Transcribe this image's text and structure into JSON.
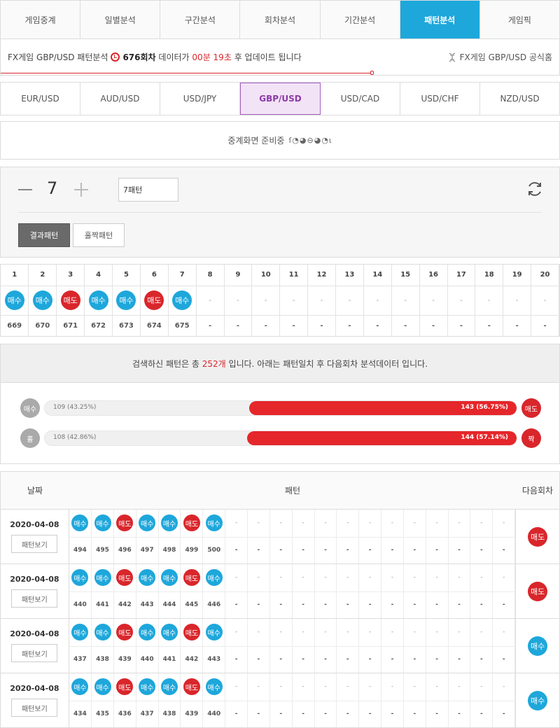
{
  "nav": {
    "tabs": [
      "게임중계",
      "일별분석",
      "구간분석",
      "회차분석",
      "기간분석",
      "패턴분석",
      "게임픽"
    ],
    "active_index": 5
  },
  "info": {
    "prefix": "FX게임 GBP/USD 패턴분석",
    "round": "676회차",
    "middle": "데이터가",
    "countdown": "00분 19초",
    "suffix": "후 업데이트 됩니다",
    "official_link": "FX게임 GBP/USD 공식홈"
  },
  "pairs": {
    "items": [
      "EUR/USD",
      "AUD/USD",
      "USD/JPY",
      "GBP/USD",
      "USD/CAD",
      "USD/CHF",
      "NZD/USD"
    ],
    "active_index": 3
  },
  "notice": {
    "text": "중계화면 준비중",
    "loader": "ſ◔◕⊖◕◔ɩ"
  },
  "control": {
    "stepper_value": "7",
    "pattern_select": "7패턴",
    "result_pattern_label": "결과패턴",
    "oddeven_pattern_label": "홀짝패턴"
  },
  "grid": {
    "columns": [
      "1",
      "2",
      "3",
      "4",
      "5",
      "6",
      "7",
      "8",
      "9",
      "10",
      "11",
      "12",
      "13",
      "14",
      "15",
      "16",
      "17",
      "18",
      "19",
      "20"
    ],
    "results": [
      "매수",
      "매수",
      "매도",
      "매수",
      "매수",
      "매도",
      "매수",
      "-",
      "-",
      "-",
      "-",
      "-",
      "-",
      "-",
      "-",
      "-",
      "-",
      "-",
      "-",
      "-"
    ],
    "rounds": [
      "669",
      "670",
      "671",
      "672",
      "673",
      "674",
      "675",
      "-",
      "-",
      "-",
      "-",
      "-",
      "-",
      "-",
      "-",
      "-",
      "-",
      "-",
      "-",
      "-"
    ]
  },
  "summary": {
    "prefix": "검색하신 패턴은 총",
    "count": "252개",
    "suffix": "입니다. 아래는 패턴일치 후 다음회차 분석데이터 입니다."
  },
  "stats": {
    "buy_sell": {
      "left_label": "매수",
      "left_text": "109 (43.25%)",
      "right_text": "143 (56.75%)",
      "right_label": "매도",
      "right_pct": 56.75
    },
    "odd_even": {
      "left_label": "홀",
      "left_text": "108 (42.86%)",
      "right_text": "144 (57.14%)",
      "right_label": "짝",
      "right_pct": 57.14
    }
  },
  "history": {
    "head": {
      "date": "날짜",
      "pattern": "패턴",
      "next": "다음회차"
    },
    "view_label": "패턴보기",
    "rows": [
      {
        "date": "2020-04-08",
        "results": [
          "매수",
          "매수",
          "매도",
          "매수",
          "매수",
          "매도",
          "매수"
        ],
        "rounds": [
          "494",
          "495",
          "496",
          "497",
          "498",
          "499",
          "500"
        ],
        "next": "매도"
      },
      {
        "date": "2020-04-08",
        "results": [
          "매수",
          "매수",
          "매도",
          "매수",
          "매수",
          "매도",
          "매수"
        ],
        "rounds": [
          "440",
          "441",
          "442",
          "443",
          "444",
          "445",
          "446"
        ],
        "next": "매도"
      },
      {
        "date": "2020-04-08",
        "results": [
          "매수",
          "매수",
          "매도",
          "매수",
          "매수",
          "매도",
          "매수"
        ],
        "rounds": [
          "437",
          "438",
          "439",
          "440",
          "441",
          "442",
          "443"
        ],
        "next": "매수"
      },
      {
        "date": "2020-04-08",
        "results": [
          "매수",
          "매수",
          "매도",
          "매수",
          "매수",
          "매도",
          "매수"
        ],
        "rounds": [
          "434",
          "435",
          "436",
          "437",
          "438",
          "439",
          "440"
        ],
        "next": "매수"
      }
    ]
  },
  "colors": {
    "accent": "#1ea7db",
    "buy": "#1ea7db",
    "sell": "#d9262b",
    "active_pair_bg": "#f3e3f6"
  },
  "icons": {
    "clock": "clock-icon",
    "refresh": "refresh-icon",
    "official": "dna-icon"
  }
}
